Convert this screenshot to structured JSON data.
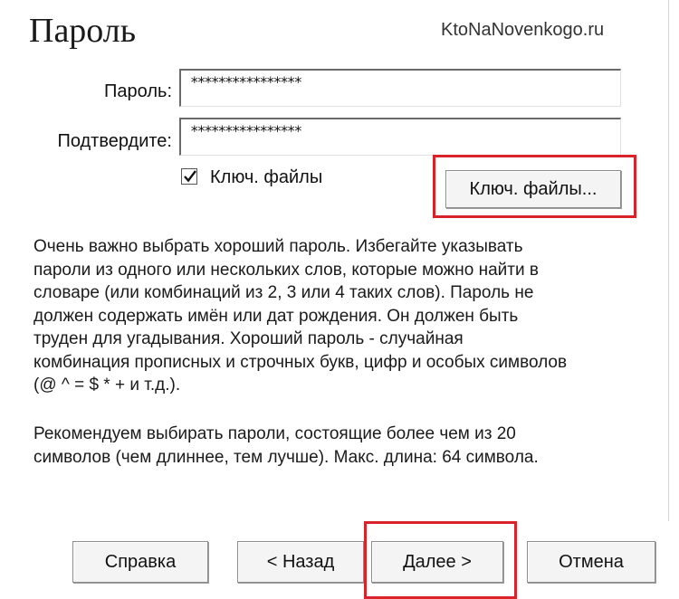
{
  "title": "Пароль",
  "watermark": "KtoNaNovenkogo.ru",
  "form": {
    "password_label": "Пароль:",
    "password_value": "****************",
    "confirm_label": "Подтвердите:",
    "confirm_value": "****************",
    "keyfiles_checkbox_label": "Ключ. файлы",
    "keyfiles_checked": true,
    "keyfiles_button": "Ключ. файлы..."
  },
  "help_text": {
    "paragraph1": "Очень важно выбрать хороший пароль. Избегайте указывать\nпароли из одного или нескольких слов, которые можно найти в\nсловаре (или комбинаций из 2, 3 или 4 таких слов). Пароль не\nдолжен содержать имён или дат рождения. Он должен быть\nтруден для угадывания. Хороший пароль - случайная\nкомбинация прописных и строчных букв, цифр и особых символов\n(@ ^ = $ * + и т.д.).",
    "paragraph2": "Рекомендуем выбирать пароли, состоящие более чем из 20\nсимволов (чем длиннее, тем лучше). Макс. длина: 64 символа."
  },
  "footer": {
    "help_button": "Справка",
    "back_button": "< Назад",
    "next_button": "Далее >",
    "cancel_button": "Отмена"
  },
  "colors": {
    "highlight": "#d8232a",
    "button_bg": "#f4f4f4"
  }
}
